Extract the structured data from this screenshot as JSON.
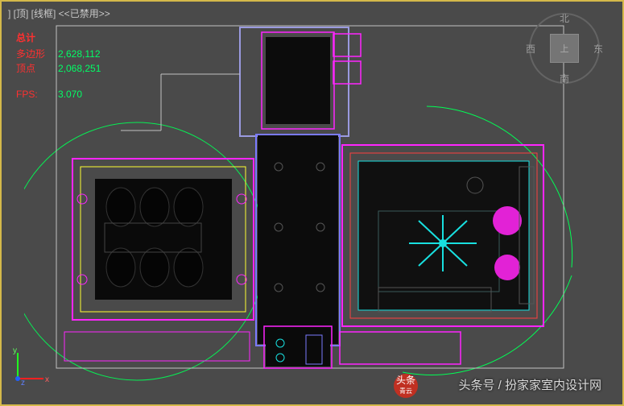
{
  "viewport": {
    "label": "] [顶]  [线框]  <<已禁用>>"
  },
  "stats": {
    "header": "总计",
    "polys_label": "多边形",
    "polys_value": "2,628,112",
    "verts_label": "顶点",
    "verts_value": "2,068,251",
    "fps_label": "FPS:",
    "fps_value": "3.070"
  },
  "viewcube": {
    "face": "上",
    "n": "北",
    "s": "南",
    "e": "东",
    "w": "西"
  },
  "axis": {
    "x": "x",
    "y": "y",
    "z": "z"
  },
  "watermark": {
    "text": "头条号 / 扮家家室内设计网",
    "logo_line1": "头条",
    "logo_line2": "青云"
  },
  "status": {
    "text": ""
  },
  "colors": {
    "wire_magenta": "#ff25ff",
    "wire_cyan": "#18e0e0",
    "wire_green": "#00ff55",
    "wire_yellow": "#ffff33",
    "wire_blue": "#7a7aff",
    "wire_red": "#ff4040",
    "wire_dk": "#101010"
  }
}
